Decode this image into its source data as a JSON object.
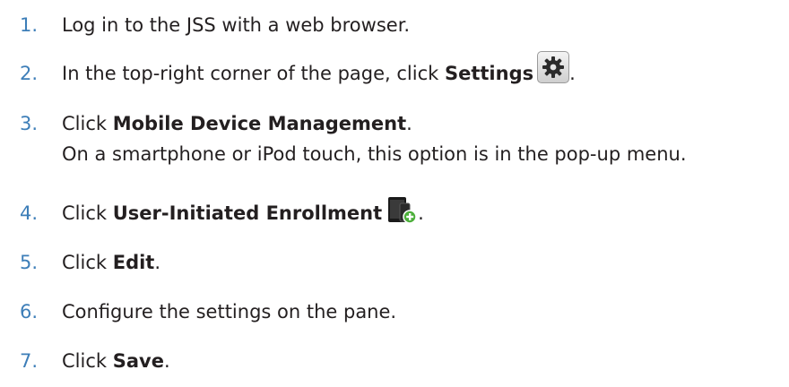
{
  "steps": [
    {
      "number": "1.",
      "text": "Log in to the JSS with a web browser."
    },
    {
      "number": "2.",
      "before": "In the top-right corner of the page, click ",
      "bold": "Settings",
      "icon": "gear-icon",
      "after": "."
    },
    {
      "number": "3.",
      "before": "Click ",
      "bold": "Mobile Device Management",
      "after": ".",
      "note": "On a smartphone or iPod touch, this option is in the pop-up menu."
    },
    {
      "number": "4.",
      "before": "Click ",
      "bold": "User-Initiated Enrollment",
      "icon": "mobile-device-add-icon",
      "after": "."
    },
    {
      "number": "5.",
      "before": "Click ",
      "bold": "Edit",
      "after": "."
    },
    {
      "number": "6.",
      "text": "Configure the settings on the pane."
    },
    {
      "number": "7.",
      "before": "Click ",
      "bold": "Save",
      "after": "."
    }
  ],
  "colors": {
    "step_number": "#3d7eb8",
    "text": "#231f20",
    "add_badge": "#4caf3a"
  }
}
